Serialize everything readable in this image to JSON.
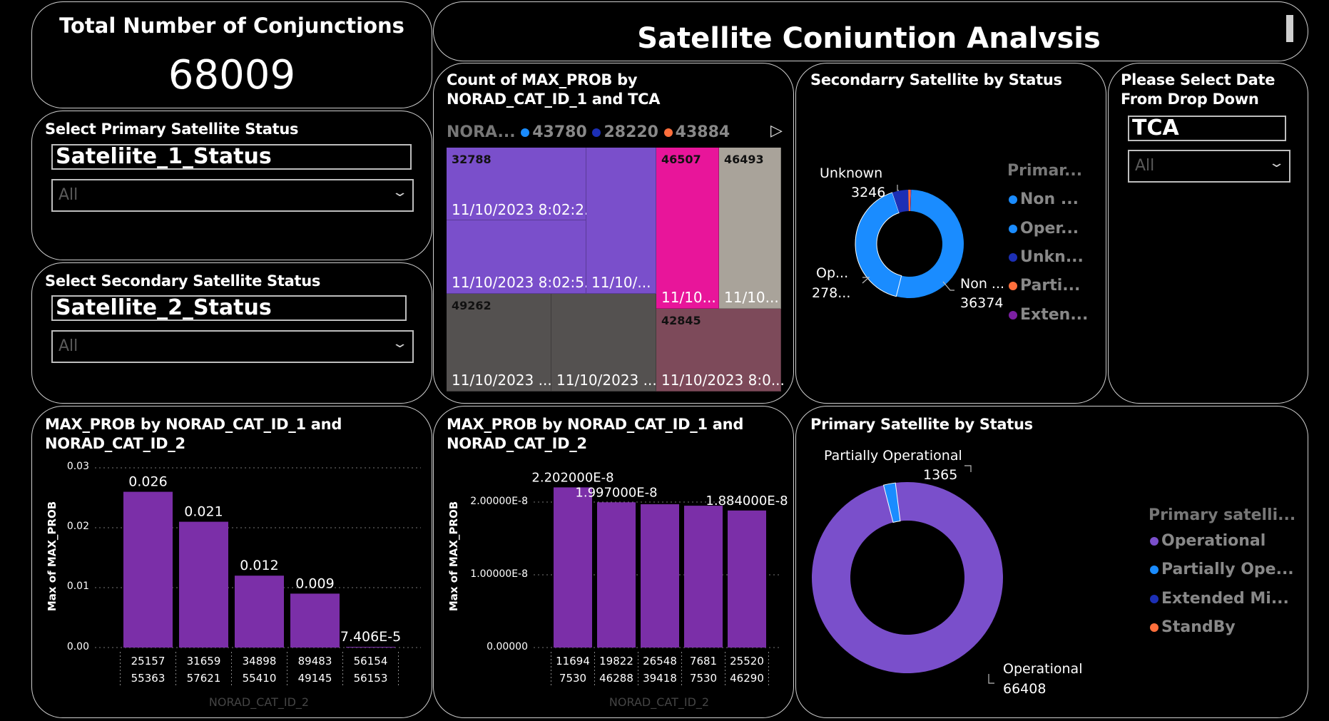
{
  "kpi": {
    "title": "Total Number of Conjunctions",
    "value": "68009"
  },
  "header": {
    "title": "Satellite Coniuntion Analvsis"
  },
  "primary_slicer": {
    "title": "Select Primary Satellite Status",
    "field": "Sateliite_1_Status",
    "value": "All"
  },
  "secondary_slicer": {
    "title": "Select Secondary Satellite Status",
    "field": "Satellite_2_Status",
    "value": "All"
  },
  "date_slicer": {
    "title": "Please Select Date From Drop Down",
    "field": "TCA",
    "value": "All"
  },
  "treemap": {
    "title": "Count of MAX_PROB by NORAD_CAT_ID_1 and TCA",
    "legend_prefix": "NORA...",
    "legend": [
      {
        "label": "43780",
        "color": "#1a8cff"
      },
      {
        "label": "28220",
        "color": "#1c2fb5"
      },
      {
        "label": "43884",
        "color": "#ff6f3c"
      }
    ],
    "tiles": [
      {
        "id": "32788",
        "label": "",
        "color": "#7a4fcb"
      },
      {
        "id": "",
        "label": "11/10/2023 8:02:2...",
        "color": "#7a4fcb"
      },
      {
        "id": "",
        "label": "11/10/2023 8:02:5...",
        "color": "#7a4fcb"
      },
      {
        "id": "",
        "label": "11/10/...",
        "color": "#7a4fcb"
      },
      {
        "id": "46507",
        "label": "11/10...",
        "color": "#e8159a"
      },
      {
        "id": "46493",
        "label": "11/10...",
        "color": "#a9a39a"
      },
      {
        "id": "49262",
        "label": "11/10/2023 ...",
        "color": "#545150"
      },
      {
        "id": "",
        "label": "11/10/2023 ...",
        "color": "#545150"
      },
      {
        "id": "42845",
        "label": "11/10/2023 8:0...",
        "color": "#7d4a5a"
      }
    ]
  },
  "secondary_donut": {
    "title": "Secondarry Satellite by Status",
    "legend_title": "Primar...",
    "legend": [
      {
        "label": "Non ...",
        "color": "#1a8cff"
      },
      {
        "label": "Oper...",
        "color": "#1a8cff"
      },
      {
        "label": "Unkn...",
        "color": "#1c2fb5"
      },
      {
        "label": "Parti...",
        "color": "#ff6f3c"
      },
      {
        "label": "Exten...",
        "color": "#7b1fa2"
      }
    ],
    "labels": {
      "unknown_name": "Unknown",
      "unknown_value": "3246",
      "op_name": "Op...",
      "op_value": "278...",
      "non_name": "Non ...",
      "non_value": "36374"
    }
  },
  "bar1": {
    "title": "MAX_PROB by NORAD_CAT_ID_1 and NORAD_CAT_ID_2",
    "ylabel": "Max of MAX_PROB",
    "xlabel": "NORAD_CAT_ID_2",
    "ticks": [
      "0.00",
      "0.01",
      "0.02",
      "0.03"
    ]
  },
  "bar2": {
    "title": "MAX_PROB by NORAD_CAT_ID_1 and NORAD_CAT_ID_2",
    "ylabel": "Max of MAX_PROB",
    "xlabel": "NORAD_CAT_ID_2",
    "ticks": [
      "0.00000",
      "1.00000E-8",
      "2.00000E-8"
    ]
  },
  "primary_donut": {
    "title": "Primary Satellite by Status",
    "legend_title": "Primary satelli...",
    "legend": [
      {
        "label": "Operational",
        "color": "#7a4fcb"
      },
      {
        "label": "Partially Ope...",
        "color": "#1a8cff"
      },
      {
        "label": "Extended Mi...",
        "color": "#1c2fb5"
      },
      {
        "label": "StandBy",
        "color": "#ff6f3c"
      }
    ],
    "labels": {
      "partial_name": "Partially Operational",
      "partial_value": "1365",
      "oper_name": "Operational",
      "oper_value": "66408"
    }
  },
  "chart_data": [
    {
      "type": "bar",
      "title": "MAX_PROB by NORAD_CAT_ID_1 and NORAD_CAT_ID_2",
      "xlabel": "NORAD_CAT_ID_2",
      "ylabel": "Max of MAX_PROB",
      "categories": [
        [
          "25157",
          "55363"
        ],
        [
          "31659",
          "57621"
        ],
        [
          "34898",
          "55410"
        ],
        [
          "89483",
          "49145"
        ],
        [
          "56154",
          "56153"
        ]
      ],
      "values": [
        0.026,
        0.021,
        0.012,
        0.009,
        7.406e-05
      ],
      "data_labels": [
        "0.026",
        "0.021",
        "0.012",
        "0.009",
        "7.406E-5"
      ],
      "ylim": [
        0,
        0.03
      ],
      "color": "#7b2fa8",
      "grid": true
    },
    {
      "type": "bar",
      "title": "MAX_PROB by NORAD_CAT_ID_1 and NORAD_CAT_ID_2",
      "xlabel": "NORAD_CAT_ID_2",
      "ylabel": "Max of MAX_PROB",
      "categories": [
        [
          "11694",
          "7530"
        ],
        [
          "19822",
          "46288"
        ],
        [
          "26548",
          "39418"
        ],
        [
          "7681",
          "7530"
        ],
        [
          "25520",
          "46290"
        ]
      ],
      "values": [
        2.202e-08,
        1.997e-08,
        1.97e-08,
        1.95e-08,
        1.884e-08
      ],
      "data_labels": [
        "2.202000E-8",
        "1.997000E-8",
        "",
        "",
        "1.884000E-8"
      ],
      "ylim": [
        0,
        2.5e-08
      ],
      "color": "#7b2fa8",
      "grid": true
    },
    {
      "type": "pie",
      "title": "Secondarry Satellite by Status",
      "categories": [
        "Non Operational",
        "Operational",
        "Unknown",
        "Partially Operational",
        "Extended Mission"
      ],
      "values": [
        36374,
        27800,
        3246,
        500,
        89
      ],
      "colors": [
        "#1a8cff",
        "#1a8cff",
        "#1c2fb5",
        "#ff6f3c",
        "#7b1fa2"
      ]
    },
    {
      "type": "pie",
      "title": "Primary Satellite by Status",
      "categories": [
        "Operational",
        "Partially Operational"
      ],
      "values": [
        66408,
        1365
      ],
      "colors": [
        "#7a4fcb",
        "#1a8cff"
      ]
    }
  ]
}
